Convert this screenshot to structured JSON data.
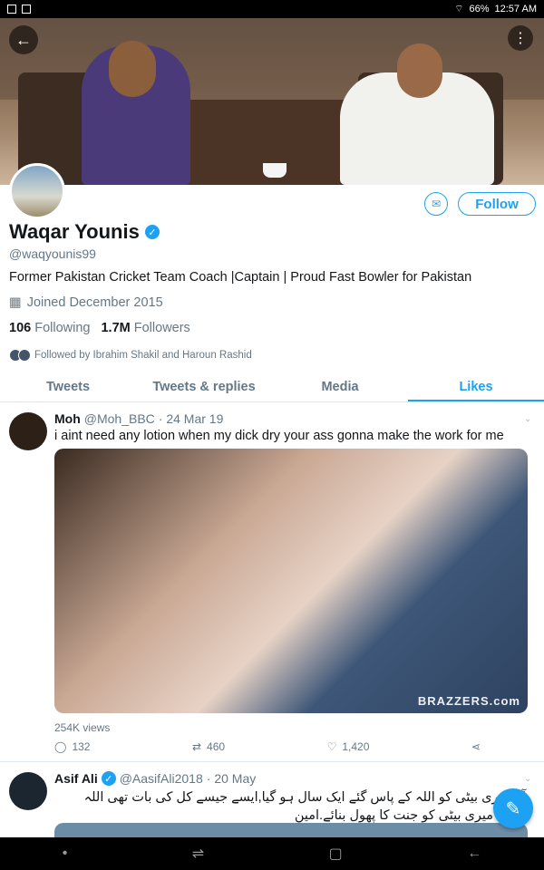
{
  "statusbar": {
    "battery": "66%",
    "time": "12:57 AM"
  },
  "profile": {
    "name": "Waqar Younis",
    "handle": "@waqyounis99",
    "bio": "Former Pakistan Cricket Team Coach |Captain | Proud Fast Bowler for Pakistan",
    "joined": "Joined December 2015",
    "following_count": "106",
    "following_label": "Following",
    "followers_count": "1.7M",
    "followers_label": "Followers",
    "followed_by": "Followed by Ibrahim Shakil and Haroun Rashid",
    "follow_label": "Follow"
  },
  "tabs": [
    {
      "label": "Tweets"
    },
    {
      "label": "Tweets & replies"
    },
    {
      "label": "Media"
    },
    {
      "label": "Likes",
      "active": true
    }
  ],
  "tweets": [
    {
      "author": "Moh",
      "handle": "@Moh_BBC",
      "date": "· 24 Mar 19",
      "text": "i aint need any lotion when my dick dry your ass gonna make the work for me",
      "media_watermark": "BRAZZERS.com",
      "views": "254K views",
      "replies": "132",
      "retweets": "460",
      "likes": "1,420"
    },
    {
      "author": "Asif Ali",
      "handle": "@AasifAli2018",
      "date": "· 20 May",
      "text": "آج میری بیٹی کو اللہ کے پاس گئے ایک سال ہو گیا,ایسے جیسے کل کی بات تھی اللہ تعالی میری بیٹی کو جنت کا پھول بنائے.امین"
    }
  ],
  "icons": {
    "back": "back-arrow-icon",
    "more": "more-vertical-icon",
    "dm": "envelope-icon",
    "verified": "verified-badge-icon",
    "calendar": "calendar-icon",
    "reply": "reply-icon",
    "retweet": "retweet-icon",
    "like": "heart-icon",
    "share": "share-icon",
    "compose": "compose-tweet-icon"
  },
  "colors": {
    "accent": "#1da1f2",
    "muted": "#657786",
    "text": "#14171a"
  }
}
